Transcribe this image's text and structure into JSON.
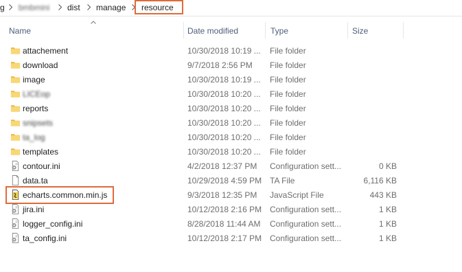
{
  "breadcrumb": {
    "leading": "g",
    "hidden_segment": "bmbmini",
    "segments": [
      "dist",
      "manage",
      "resource"
    ]
  },
  "columns": {
    "name": "Name",
    "date_modified": "Date modified",
    "type": "Type",
    "size": "Size"
  },
  "files": [
    {
      "name": "attachement",
      "date": "10/30/2018 10:19 ...",
      "type": "File folder",
      "size": "",
      "icon": "folder-icon",
      "blurred": false
    },
    {
      "name": "download",
      "date": "9/7/2018 2:56 PM",
      "type": "File folder",
      "size": "",
      "icon": "folder-icon",
      "blurred": false
    },
    {
      "name": "image",
      "date": "10/30/2018 10:19 ...",
      "type": "File folder",
      "size": "",
      "icon": "folder-icon",
      "blurred": false
    },
    {
      "name": "LICEop",
      "date": "10/30/2018 10:20 ...",
      "type": "File folder",
      "size": "",
      "icon": "folder-icon",
      "blurred": true
    },
    {
      "name": "reports",
      "date": "10/30/2018 10:20 ...",
      "type": "File folder",
      "size": "",
      "icon": "folder-icon",
      "blurred": false
    },
    {
      "name": "snipsets",
      "date": "10/30/2018 10:20 ...",
      "type": "File folder",
      "size": "",
      "icon": "folder-icon",
      "blurred": true
    },
    {
      "name": "ta_log",
      "date": "10/30/2018 10:20 ...",
      "type": "File folder",
      "size": "",
      "icon": "folder-icon",
      "blurred": true
    },
    {
      "name": "templates",
      "date": "10/30/2018 10:20 ...",
      "type": "File folder",
      "size": "",
      "icon": "folder-icon",
      "blurred": false
    },
    {
      "name": "contour.ini",
      "date": "4/2/2018 12:37 PM",
      "type": "Configuration sett...",
      "size": "0 KB",
      "icon": "config-file-icon",
      "blurred": false
    },
    {
      "name": "data.ta",
      "date": "10/29/2018 4:59 PM",
      "type": "TA File",
      "size": "6,116 KB",
      "icon": "blank-file-icon",
      "blurred": false
    },
    {
      "name": "echarts.common.min.js",
      "date": "9/3/2018 12:35 PM",
      "type": "JavaScript File",
      "size": "443 KB",
      "icon": "javascript-file-icon",
      "blurred": false
    },
    {
      "name": "jira.ini",
      "date": "10/12/2018 2:16 PM",
      "type": "Configuration sett...",
      "size": "1 KB",
      "icon": "config-file-icon",
      "blurred": false
    },
    {
      "name": "logger_config.ini",
      "date": "8/28/2018 11:44 AM",
      "type": "Configuration sett...",
      "size": "1 KB",
      "icon": "config-file-icon",
      "blurred": false
    },
    {
      "name": "ta_config.ini",
      "date": "10/12/2018 2:17 PM",
      "type": "Configuration sett...",
      "size": "1 KB",
      "icon": "config-file-icon",
      "blurred": false
    }
  ],
  "colors": {
    "highlight_border": "#e06a3a",
    "folder": "#f8d775",
    "header_text": "#4c607a",
    "secondary_text": "#6d6d6d"
  }
}
